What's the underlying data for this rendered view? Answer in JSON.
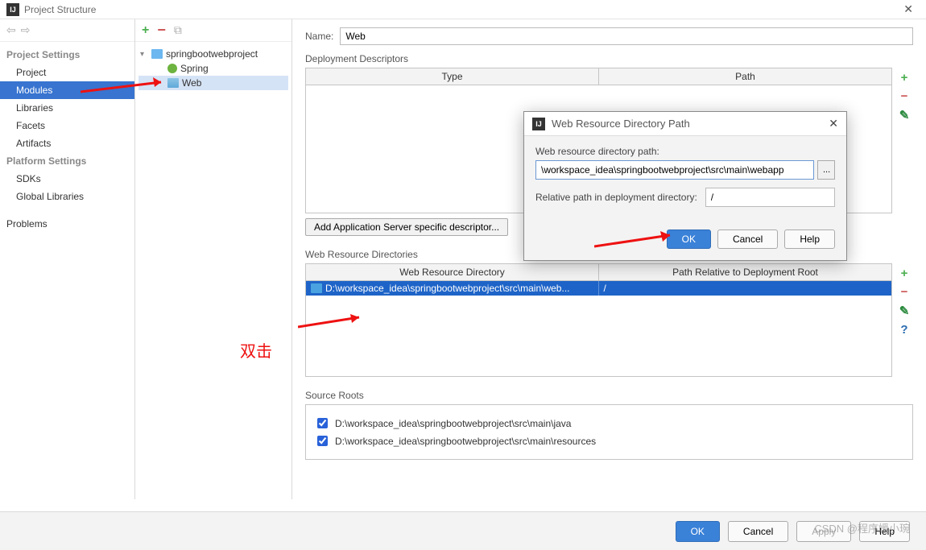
{
  "window": {
    "title": "Project Structure",
    "close": "✕"
  },
  "sidebar": {
    "nav_back": "⇦",
    "nav_fwd": "⇨",
    "sections": [
      {
        "heading": "Project Settings",
        "items": [
          "Project",
          "Modules",
          "Libraries",
          "Facets",
          "Artifacts"
        ],
        "selected": 1
      },
      {
        "heading": "Platform Settings",
        "items": [
          "SDKs",
          "Global Libraries"
        ]
      },
      {
        "heading": "",
        "items": [
          "Problems"
        ]
      }
    ]
  },
  "tree": {
    "toolbar": {
      "add": "+",
      "remove": "−",
      "copy": "⧉"
    },
    "root": "springbootwebproject",
    "children": [
      {
        "icon": "spring",
        "label": "Spring"
      },
      {
        "icon": "web",
        "label": "Web",
        "selected": true
      }
    ]
  },
  "form": {
    "name_label": "Name:",
    "name_value": "Web",
    "dd_label": "Deployment Descriptors",
    "dd_headers": [
      "Type",
      "Path"
    ],
    "dd_button": "Add Application Server specific descriptor...",
    "wrd_label": "Web Resource Directories",
    "wrd_headers": [
      "Web Resource Directory",
      "Path Relative to Deployment Root"
    ],
    "wrd_row": {
      "dir": "D:\\workspace_idea\\springbootwebproject\\src\\main\\web...",
      "rel": "/"
    },
    "src_label": "Source Roots",
    "src_items": [
      "D:\\workspace_idea\\springbootwebproject\\src\\main\\java",
      "D:\\workspace_idea\\springbootwebproject\\src\\main\\resources"
    ]
  },
  "modal": {
    "title": "Web Resource Directory Path",
    "label1": "Web resource directory path:",
    "value1": "\\workspace_idea\\springbootwebproject\\src\\main\\webapp",
    "browse": "...",
    "label2": "Relative path in deployment directory:",
    "value2": "/",
    "ok": "OK",
    "cancel": "Cancel",
    "help": "Help",
    "close": "✕"
  },
  "bottom": {
    "ok": "OK",
    "cancel": "Cancel",
    "apply": "Apply",
    "help": "Help"
  },
  "annotations": {
    "dblclick": "双击"
  },
  "watermark": "CSDN @程序媛小琬"
}
